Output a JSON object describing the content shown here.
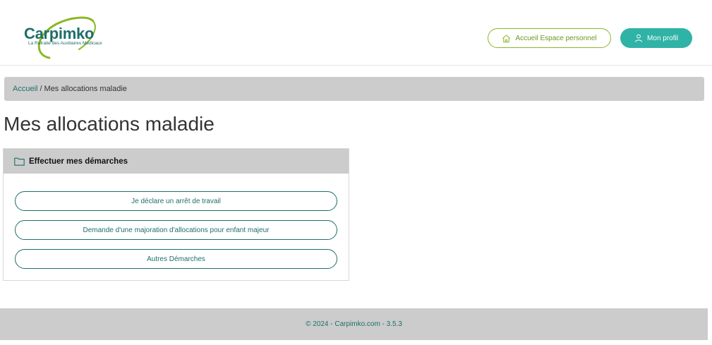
{
  "brand": {
    "name": "Carpimko",
    "tagline": "La Retraite des Auxiliaires Médicaux",
    "primary_color": "#1e6e6a",
    "accent_color": "#2fb3a6",
    "green_color": "#8ab825"
  },
  "header": {
    "home_button": {
      "label": "Accueil Espace personnel",
      "icon": "home-icon"
    },
    "profile_button": {
      "label": "Mon profil",
      "icon": "user-icon"
    }
  },
  "breadcrumb": {
    "home": "Accueil",
    "separator": "/",
    "current": "Mes allocations maladie"
  },
  "page": {
    "title": "Mes allocations maladie"
  },
  "panel": {
    "icon": "folder-icon",
    "title": "Effectuer mes démarches",
    "actions": [
      {
        "label": "Je déclare un arrêt de travail"
      },
      {
        "label": "Demande d'une majoration d'allocations pour enfant majeur"
      },
      {
        "label": "Autres Démarches"
      }
    ]
  },
  "footer": {
    "text": "© 2024 - Carpimko.com - 3.5.3"
  }
}
